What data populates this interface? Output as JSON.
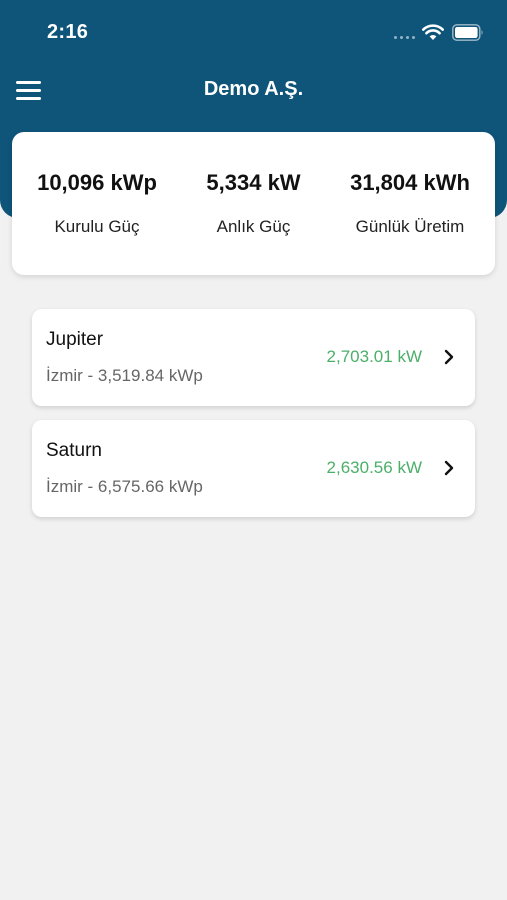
{
  "status_bar": {
    "time": "2:16"
  },
  "nav": {
    "title": "Demo A.Ş."
  },
  "colors": {
    "header": "#0f5479",
    "background": "#f1f1f1",
    "power_green": "#4caf6a"
  },
  "summary": {
    "stats": [
      {
        "value": "10,096 kWp",
        "label": "Kurulu Güç"
      },
      {
        "value": "5,334 kW",
        "label": "Anlık Güç"
      },
      {
        "value": "31,804 kWh",
        "label": "Günlük Üretim"
      }
    ]
  },
  "plants": [
    {
      "name": "Jupiter",
      "subtitle": "İzmir - 3,519.84 kWp",
      "power": "2,703.01 kW"
    },
    {
      "name": "Saturn",
      "subtitle": "İzmir - 6,575.66 kWp",
      "power": "2,630.56 kW"
    }
  ],
  "icons": {
    "menu": "hamburger-menu-icon",
    "chevron": "chevron-right-icon",
    "wifi": "wifi-icon",
    "battery": "battery-icon"
  }
}
